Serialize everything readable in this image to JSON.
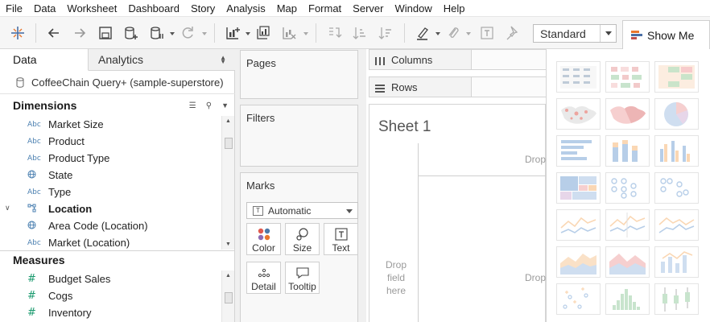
{
  "menu": [
    "File",
    "Data",
    "Worksheet",
    "Dashboard",
    "Story",
    "Analysis",
    "Map",
    "Format",
    "Server",
    "Window",
    "Help"
  ],
  "toolbar": {
    "fit_value": "Standard",
    "show_me_label": "Show Me",
    "icons": [
      "tableau-logo-icon",
      "undo-icon",
      "redo-icon",
      "save-icon",
      "new-datasource-icon",
      "pause-updates-icon",
      "refresh-icon",
      "new-worksheet-icon",
      "duplicate-sheet-icon",
      "clear-sheet-icon",
      "swap-icon",
      "sort-ascending-icon",
      "sort-descending-icon",
      "highlight-icon",
      "group-members-icon",
      "show-labels-icon",
      "pin-icon"
    ]
  },
  "data_pane": {
    "tabs": {
      "data": "Data",
      "analytics": "Analytics"
    },
    "datasource": "CoffeeChain Query+ (sample-superstore)",
    "dimensions_title": "Dimensions",
    "measures_title": "Measures",
    "dimensions": [
      {
        "type": "Abc",
        "name": "Market Size"
      },
      {
        "type": "Abc",
        "name": "Product"
      },
      {
        "type": "Abc",
        "name": "Product Type"
      },
      {
        "type": "globe",
        "name": "State"
      },
      {
        "type": "Abc",
        "name": "Type"
      },
      {
        "type": "folder",
        "name": "Location"
      },
      {
        "type": "globe",
        "name": "Area Code (Location)"
      },
      {
        "type": "Abc",
        "name": "Market (Location)"
      }
    ],
    "measures": [
      {
        "type": "#",
        "name": "Budget Sales"
      },
      {
        "type": "#",
        "name": "Cogs"
      },
      {
        "type": "#",
        "name": "Inventory"
      }
    ]
  },
  "shelves": {
    "pages": "Pages",
    "filters": "Filters",
    "marks": "Marks",
    "mark_type": "Automatic",
    "mark_buttons": {
      "color": "Color",
      "size": "Size",
      "text": "Text",
      "detail": "Detail",
      "tooltip": "Tooltip"
    },
    "text_glyph": "T"
  },
  "worksheet": {
    "columns": "Columns",
    "rows": "Rows",
    "title": "Sheet 1",
    "drop_top": "Drop",
    "drop_mid": "Drop",
    "drop_left": [
      "Drop",
      "field",
      "here"
    ]
  },
  "colors": {
    "accent": "#e8762d",
    "dimension": "#4a7fb0",
    "measure": "#1a9a6e"
  }
}
